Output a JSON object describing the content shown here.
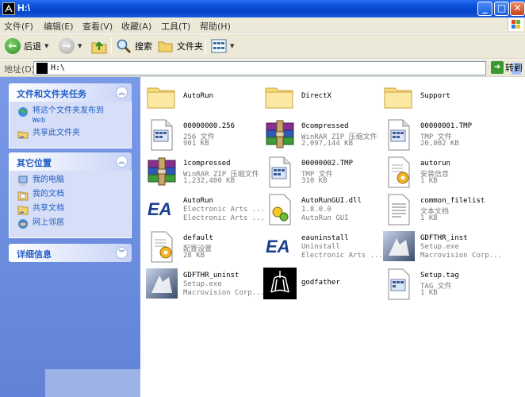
{
  "window": {
    "title": "H:\\",
    "buttons": {
      "minimize": "_",
      "maximize": "□",
      "close": "✕"
    }
  },
  "menu": [
    "文件(F)",
    "编辑(E)",
    "查看(V)",
    "收藏(A)",
    "工具(T)",
    "帮助(H)"
  ],
  "toolbar": {
    "back": "后退",
    "search": "搜索",
    "folders": "文件夹"
  },
  "address": {
    "label": "地址(D)",
    "value": "H:\\",
    "go": "转到"
  },
  "sidebar": {
    "tasks": {
      "title": "文件和文件夹任务",
      "items": [
        {
          "label": "将这个文件夹发布到",
          "sub": "Web",
          "icon": "publish-web-icon"
        },
        {
          "label": "共享此文件夹",
          "icon": "share-folder-icon"
        }
      ]
    },
    "places": {
      "title": "其它位置",
      "items": [
        {
          "label": "我的电脑",
          "icon": "my-computer-icon"
        },
        {
          "label": "我的文档",
          "icon": "my-documents-icon"
        },
        {
          "label": "共享文档",
          "icon": "shared-documents-icon"
        },
        {
          "label": "网上邻居",
          "icon": "network-places-icon"
        }
      ]
    },
    "details": {
      "title": "详细信息"
    }
  },
  "files": [
    {
      "name": "AutoRun",
      "type": "folder"
    },
    {
      "name": "DirectX",
      "type": "folder"
    },
    {
      "name": "Support",
      "type": "folder"
    },
    {
      "name": "00000000.256",
      "line2": "256 文件",
      "line3": "901 KB",
      "type": "tmp"
    },
    {
      "name": "0compressed",
      "line2": "WinRAR ZIP 压缩文件",
      "line3": "2,097,144 KB",
      "type": "rar"
    },
    {
      "name": "00000001.TMP",
      "line2": "TMP 文件",
      "line3": "20,002 KB",
      "type": "tmp"
    },
    {
      "name": "1compressed",
      "line2": "WinRAR ZIP 压缩文件",
      "line3": "1,232,400 KB",
      "type": "rar"
    },
    {
      "name": "00000002.TMP",
      "line2": "TMP 文件",
      "line3": "310 KB",
      "type": "tmp"
    },
    {
      "name": "autorun",
      "line2": "安装信息",
      "line3": "1 KB",
      "type": "inf"
    },
    {
      "name": "AutoRun",
      "line2": "Electronic Arts ...",
      "line3": "Electronic Arts ...",
      "type": "ea"
    },
    {
      "name": "AutoRunGUI.dll",
      "line2": "1.8.0.0",
      "line3": "AutoRun GUI",
      "type": "dll"
    },
    {
      "name": "common_filelist",
      "line2": "文本文档",
      "line3": "1 KB",
      "type": "txt"
    },
    {
      "name": "default",
      "line2": "配置设置",
      "line3": "28 KB",
      "type": "ini"
    },
    {
      "name": "eauninstall",
      "line2": "Uninstall",
      "line3": "Electronic Arts ...",
      "type": "ea"
    },
    {
      "name": "GDFTHR_inst",
      "line2": "Setup.exe",
      "line3": "Macrovision Corp...",
      "type": "setup"
    },
    {
      "name": "GDFTHR_uninst",
      "line2": "Setup.exe",
      "line3": "Macrovision Corp...",
      "type": "setup"
    },
    {
      "name": "godfather",
      "type": "godfather"
    },
    {
      "name": "Setup.tag",
      "line2": "TAG 文件",
      "line3": "1 KB",
      "type": "tag"
    }
  ],
  "colors": {
    "titlebar": "#0a4fd8",
    "sidebar": "#6d8ce0",
    "link": "#215dc6"
  }
}
